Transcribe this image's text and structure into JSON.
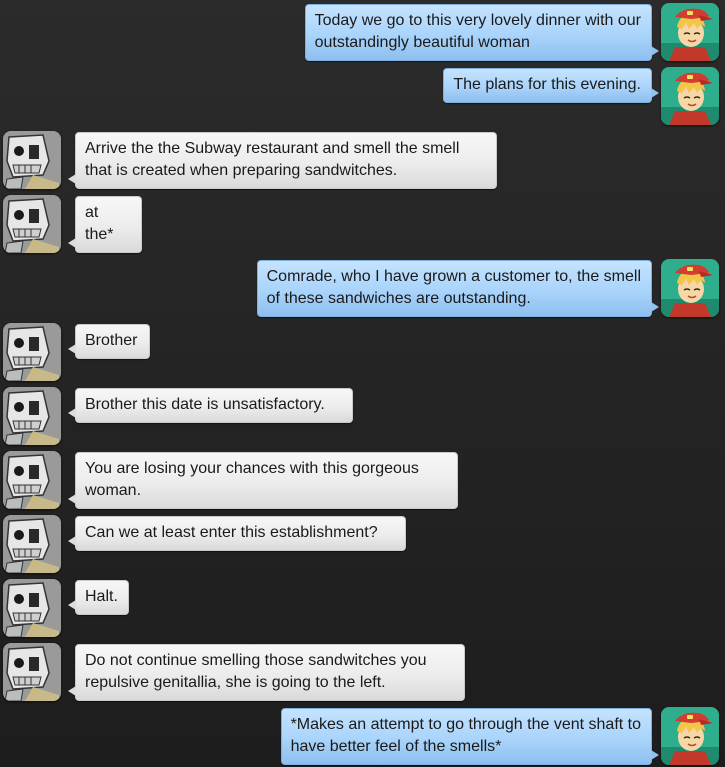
{
  "messages": [
    {
      "side": "right",
      "sender": "human",
      "text": "Today we go to this very lovely dinner with our\noutstandingly beautiful woman"
    },
    {
      "side": "right",
      "sender": "human",
      "text": "The plans for this evening."
    },
    {
      "side": "left",
      "sender": "robot",
      "text": "Arrive the the Subway restaurant and smell the smell\nthat is created when preparing sandwitches."
    },
    {
      "side": "left",
      "sender": "robot",
      "text": "at the*"
    },
    {
      "side": "right",
      "sender": "human",
      "text": "Comrade, who I have grown a customer to, the smell\nof these sandwiches are outstanding."
    },
    {
      "side": "left",
      "sender": "robot",
      "text": "Brother"
    },
    {
      "side": "left",
      "sender": "robot",
      "text": "Brother this date is unsatisfactory."
    },
    {
      "side": "left",
      "sender": "robot",
      "text": "You are losing your chances with this gorgeous\nwoman."
    },
    {
      "side": "left",
      "sender": "robot",
      "text": "Can we at least enter this establishment?"
    },
    {
      "side": "left",
      "sender": "robot",
      "text": "Halt."
    },
    {
      "side": "left",
      "sender": "robot",
      "text": "Do not continue smelling those sandwitches you\nrepulsive genitallia, she is going to the left."
    },
    {
      "side": "right",
      "sender": "human",
      "text": "*Makes an attempt to go through the vent shaft to\nhave better feel of the smells*"
    }
  ],
  "avatars": {
    "human": {
      "icon": "blonde-character-red-cap-avatar-icon",
      "background": "#2fae8e"
    },
    "robot": {
      "icon": "skull-robot-avatar-icon",
      "background": "#9a9a9a"
    }
  },
  "colors": {
    "outgoing_bubble": "#a9d4fb",
    "incoming_bubble": "#ececec",
    "background": "#242424"
  }
}
